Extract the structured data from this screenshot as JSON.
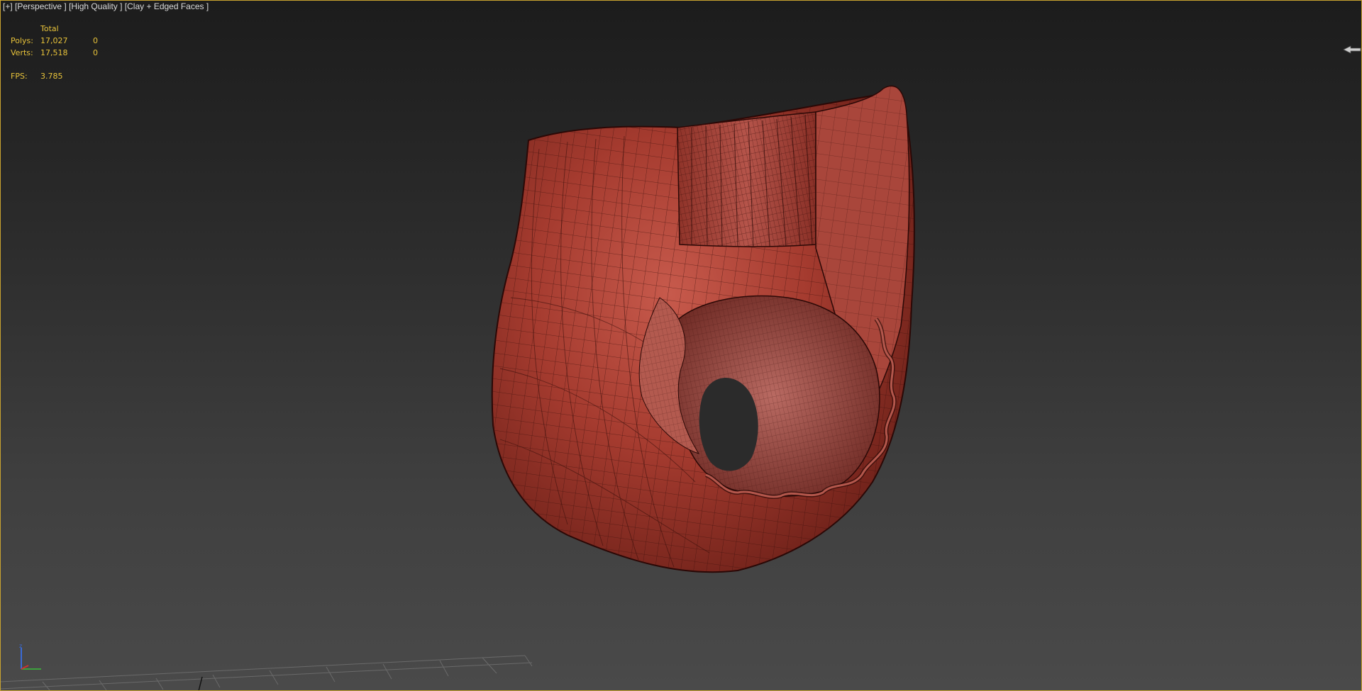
{
  "viewport": {
    "label": {
      "plus": "[+]",
      "view": "[Perspective ]",
      "quality": "[High Quality ]",
      "shading": "[Clay + Edged Faces ]"
    },
    "stats": {
      "header": "Total",
      "rows": [
        {
          "name": "Polys:",
          "total": "17,027",
          "selected": "0"
        },
        {
          "name": "Verts:",
          "total": "17,518",
          "selected": "0"
        }
      ],
      "fps_name": "FPS:",
      "fps_value": "3.785"
    },
    "colors": {
      "stats_text": "#e8c33a",
      "active_border": "#c9a330",
      "model_clay": "#9a3328"
    },
    "icons": {
      "viewcube": "viewcube-arrow-icon",
      "axis": "axis-tripod-icon"
    }
  }
}
